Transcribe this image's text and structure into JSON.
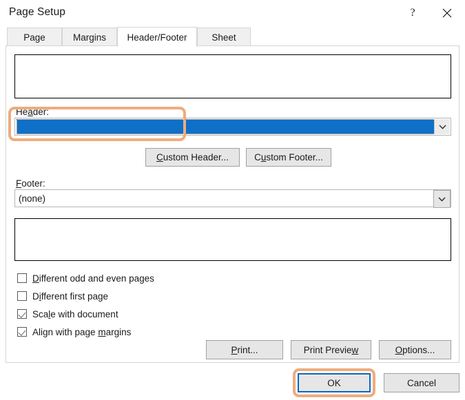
{
  "window": {
    "title": "Page Setup",
    "help_icon": "question-mark-icon",
    "close_icon": "close-icon"
  },
  "tabs": [
    {
      "label": "Page",
      "active": false
    },
    {
      "label": "Margins",
      "active": false
    },
    {
      "label": "Header/Footer",
      "active": true
    },
    {
      "label": "Sheet",
      "active": false
    }
  ],
  "panel": {
    "header_preview": {
      "text": ""
    },
    "footer_preview": {
      "text": ""
    },
    "header_field": {
      "label_before": "He",
      "label_accel": "a",
      "label_after": "der:",
      "value": "",
      "selected": true,
      "dropdown_icon": "chevron-down-icon"
    },
    "footer_field": {
      "label_before": "",
      "label_accel": "F",
      "label_after": "ooter:",
      "value": "(none)",
      "selected": false,
      "dropdown_icon": "chevron-down-icon"
    },
    "custom_header_button": {
      "before": "",
      "accel": "C",
      "after": "ustom Header..."
    },
    "custom_footer_button": {
      "before": "C",
      "accel": "u",
      "after": "stom Footer..."
    },
    "checkboxes": [
      {
        "before": "",
        "accel": "D",
        "after": "ifferent odd and even pages",
        "checked": false
      },
      {
        "before": "D",
        "accel": "i",
        "after": "fferent first page",
        "checked": false
      },
      {
        "before": "Sca",
        "accel": "l",
        "after": "e with document",
        "checked": true
      },
      {
        "before": "Align with page ",
        "accel": "m",
        "after": "argins",
        "checked": true
      }
    ],
    "print_button": {
      "before": "",
      "accel": "P",
      "after": "rint..."
    },
    "print_preview_button": {
      "before": "Print Previe",
      "accel": "w",
      "after": ""
    },
    "options_button": {
      "before": "",
      "accel": "O",
      "after": "ptions..."
    }
  },
  "footer_buttons": {
    "ok": "OK",
    "cancel": "Cancel"
  },
  "colors": {
    "selection_blue": "#0e70c8",
    "focus_border_blue": "#0a68c4",
    "highlight_orange": "#eeac7e",
    "button_face": "#e6e6e6",
    "dialog_background": "#ffffff"
  },
  "annotations": [
    {
      "name": "header-field-highlight",
      "target": "header combo box"
    },
    {
      "name": "ok-button-highlight",
      "target": "OK button"
    }
  ]
}
